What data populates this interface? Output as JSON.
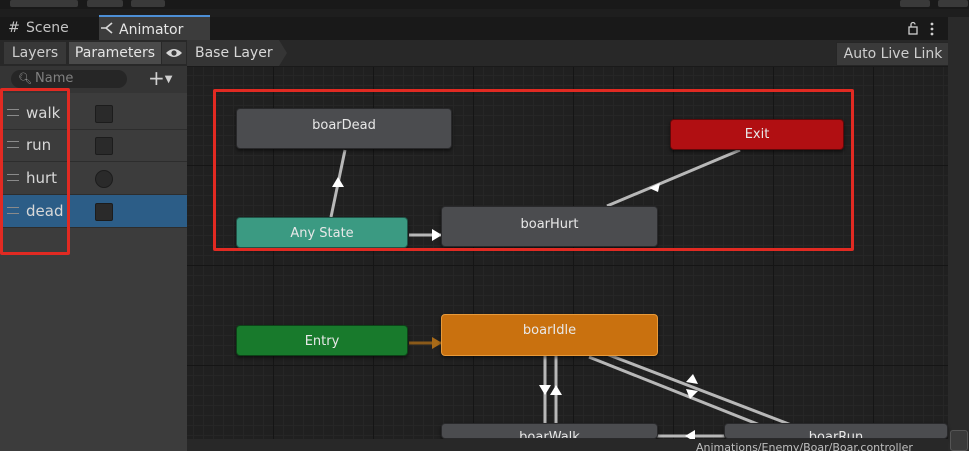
{
  "tabs": {
    "scene": {
      "label": "Scene",
      "icon": "grid-icon"
    },
    "animator": {
      "label": "Animator",
      "icon": "animator-icon"
    }
  },
  "toolbar": {
    "layers_label": "Layers",
    "parameters_label": "Parameters",
    "breadcrumb": "Base Layer",
    "auto_live_link": "Auto Live Link"
  },
  "params_panel": {
    "search_placeholder": "Name",
    "items": [
      {
        "name": "walk",
        "type": "bool",
        "value": false
      },
      {
        "name": "run",
        "type": "bool",
        "value": false
      },
      {
        "name": "hurt",
        "type": "trigger",
        "value": false
      },
      {
        "name": "dead",
        "type": "bool",
        "value": false,
        "selected": true
      }
    ]
  },
  "graph": {
    "nodes": {
      "boarDead": "boarDead",
      "exit": "Exit",
      "anyState": "Any State",
      "boarHurt": "boarHurt",
      "entry": "Entry",
      "boarIdle": "boarIdle",
      "boarWalk": "boarWalk",
      "boarRun": "boarRun"
    }
  },
  "status_bar": {
    "path": "Animations/Enemy/Boar/Boar.controller"
  },
  "colors": {
    "highlight_box": "#e12a22",
    "any_state": "#3b9a82",
    "exit": "#b10f12",
    "entry": "#187a2c",
    "default_state": "#c9710f",
    "state": "#4b4c4f",
    "selected_param": "#2c5d87"
  }
}
